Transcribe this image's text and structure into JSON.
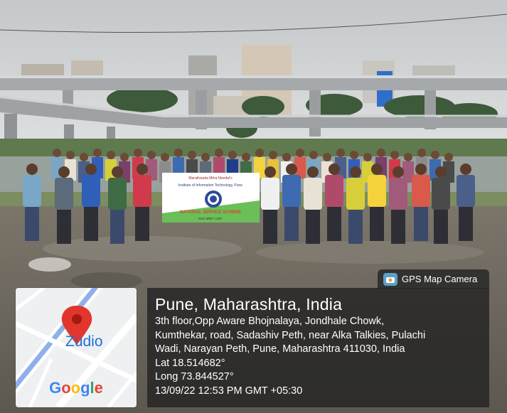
{
  "photo": {
    "banner": {
      "line1": "Marathwada Mitra Mandal's",
      "line2": "Institute of Information Technology, Pune",
      "line3": "NATIONAL SERVICE SCHEME",
      "line4": "NSS MMIT UNIT"
    }
  },
  "map": {
    "place_label": "Zudio",
    "logo_text": "Google",
    "logo_letters": [
      "G",
      "o",
      "o",
      "g",
      "l",
      "e"
    ]
  },
  "gps": {
    "app_name": "GPS Map Camera",
    "title": "Pune, Maharashtra, India",
    "address_lines": [
      "3th floor,Opp Aware Bhojnalaya, Jondhale Chowk,",
      "Kumthekar, road, Sadashiv Peth, near Alka Talkies, Pulachi",
      "Wadi, Narayan Peth, Pune, Maharashtra 411030, India"
    ],
    "lat": "Lat 18.514682°",
    "long": "Long 73.844527°",
    "datetime": "13/09/22 12:53 PM GMT +05:30"
  },
  "colors": {
    "sky": "#cfd2d4",
    "flyover": "#a8acae",
    "water": "#9aa29e",
    "ground": "#6f6a5f",
    "banner_green": "#6bbf59",
    "pin_red": "#e2362d",
    "panel": "#232323"
  }
}
